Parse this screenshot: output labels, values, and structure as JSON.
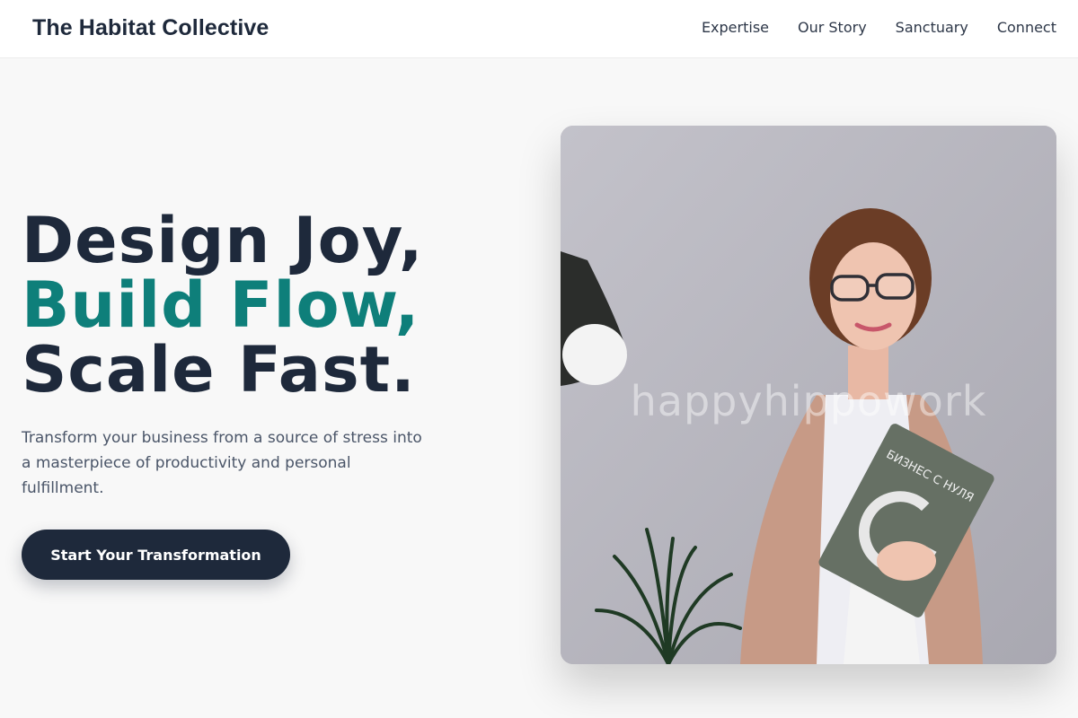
{
  "header": {
    "brand": "The Habitat Collective",
    "nav": [
      {
        "label": "Expertise"
      },
      {
        "label": "Our Story"
      },
      {
        "label": "Sanctuary"
      },
      {
        "label": "Connect"
      }
    ]
  },
  "hero": {
    "headline_line1": "Design Joy,",
    "headline_line2": "Build Flow,",
    "headline_line3": "Scale Fast.",
    "subtitle": "Transform your business from a source of stress into a masterpiece of productivity and personal fulfillment.",
    "cta_label": "Start Your Transformation",
    "image": {
      "watermark": "happyhippowork",
      "book_title": "БИЗНЕС С НУЛЯ"
    }
  },
  "colors": {
    "navy": "#1e293b",
    "teal": "#0e7f7a",
    "background": "#f8f8f8"
  }
}
